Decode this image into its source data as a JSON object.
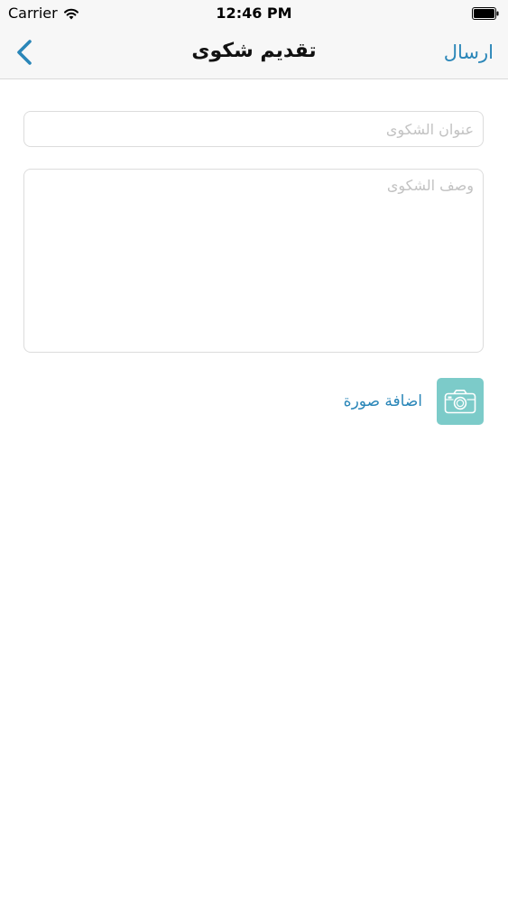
{
  "status_bar": {
    "carrier": "Carrier",
    "time": "12:46 PM"
  },
  "nav": {
    "title": "تقديم شكوى",
    "send_label": "ارسال",
    "back_icon": "chevron-left-icon",
    "accent_color": "#2a86b8"
  },
  "form": {
    "title_placeholder": "عنوان الشكوى",
    "title_value": "",
    "description_placeholder": "وصف الشكوى",
    "description_value": ""
  },
  "photo": {
    "label": "اضافة صورة",
    "icon": "camera-icon",
    "button_color": "#7ccbc9"
  }
}
